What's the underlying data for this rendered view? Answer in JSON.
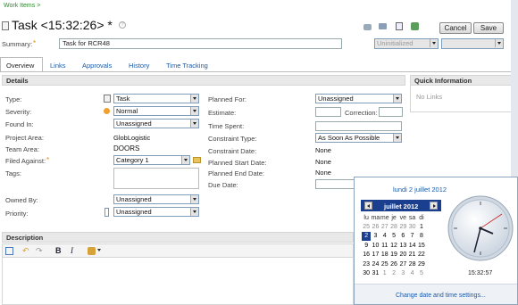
{
  "breadcrumb": "Work Items >",
  "title": "Task <15:32:26> *",
  "summary": {
    "label": "Summary:",
    "value": "Task for RCR48"
  },
  "state": {
    "value": "Uninitialized"
  },
  "buttons": {
    "cancel": "Cancel",
    "save": "Save"
  },
  "tabs": [
    "Overview",
    "Links",
    "Approvals",
    "History",
    "Time Tracking"
  ],
  "details": {
    "header": "Details",
    "left": [
      {
        "label": "Type:",
        "value": "Task"
      },
      {
        "label": "Severity:",
        "value": "Normal"
      },
      {
        "label": "Found In:",
        "value": "Unassigned"
      },
      {
        "label": "Project Area:",
        "value": "GlobLogistic"
      },
      {
        "label": "Team Area:",
        "value": "DOORS"
      },
      {
        "label": "Filed Against:",
        "value": "Category 1"
      },
      {
        "label": "Tags:",
        "value": ""
      },
      {
        "label": "Owned By:",
        "value": "Unassigned"
      },
      {
        "label": "Priority:",
        "value": "Unassigned"
      }
    ],
    "right": [
      {
        "label": "Planned For:",
        "value": "Unassigned"
      },
      {
        "label": "Estimate:",
        "value": ""
      },
      {
        "label": "Correction:",
        "value": ""
      },
      {
        "label": "Time Spent:",
        "value": ""
      },
      {
        "label": "Constraint Type:",
        "value": "As Soon As Possible"
      },
      {
        "label": "Constraint Date:",
        "value": "None"
      },
      {
        "label": "Planned Start Date:",
        "value": "None"
      },
      {
        "label": "Planned End Date:",
        "value": "None"
      },
      {
        "label": "Due Date:",
        "value": ""
      }
    ]
  },
  "quick_info": {
    "header": "Quick Information",
    "text": "No Links"
  },
  "description": {
    "header": "Description"
  },
  "clock_popup": {
    "date_heading": "lundi 2 juillet 2012",
    "month_label": "juillet 2012",
    "weekdays": [
      "lu",
      "ma",
      "me",
      "je",
      "ve",
      "sa",
      "di"
    ],
    "weeks": [
      [
        "25",
        "26",
        "27",
        "28",
        "29",
        "30",
        "1"
      ],
      [
        "2",
        "3",
        "4",
        "5",
        "6",
        "7",
        "8"
      ],
      [
        "9",
        "10",
        "11",
        "12",
        "13",
        "14",
        "15"
      ],
      [
        "16",
        "17",
        "18",
        "19",
        "20",
        "21",
        "22"
      ],
      [
        "23",
        "24",
        "25",
        "26",
        "27",
        "28",
        "29"
      ],
      [
        "30",
        "31",
        "1",
        "2",
        "3",
        "4",
        "5"
      ]
    ],
    "selected_day": "2",
    "time": "15:32:57",
    "link": "Change date and time settings..."
  }
}
